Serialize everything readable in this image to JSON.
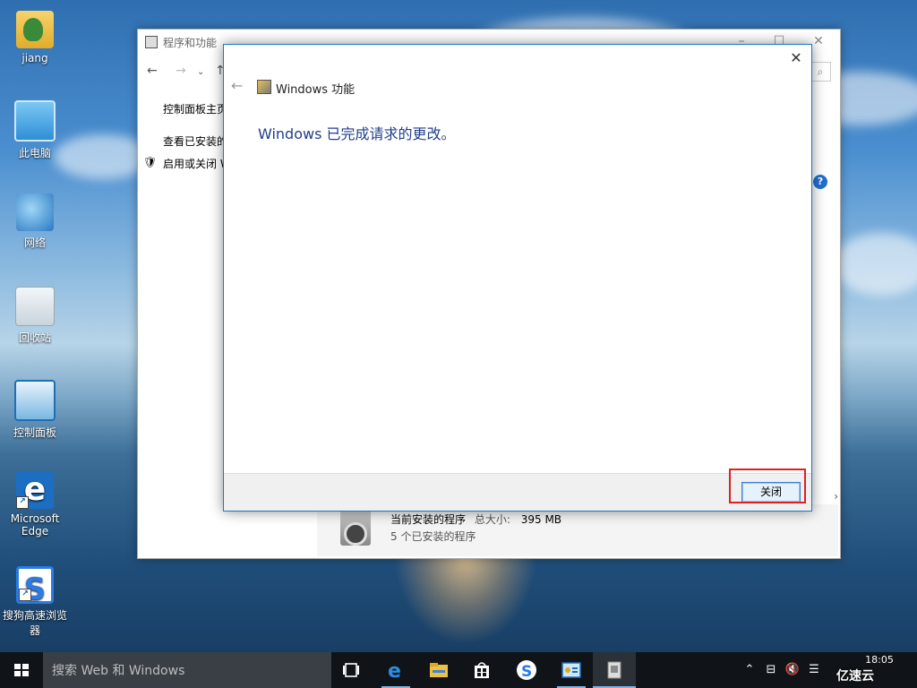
{
  "desktop": {
    "icons": [
      {
        "label": "jiang",
        "icon": "user-folder-icon"
      },
      {
        "label": "此电脑",
        "icon": "computer-icon"
      },
      {
        "label": "网络",
        "icon": "network-icon"
      },
      {
        "label": "回收站",
        "icon": "recycle-bin-icon"
      },
      {
        "label": "控制面板",
        "icon": "control-panel-icon"
      },
      {
        "label": "Microsoft Edge",
        "icon": "edge-icon"
      },
      {
        "label": "搜狗高速浏览器",
        "icon": "sogou-browser-icon"
      }
    ]
  },
  "background_window": {
    "title": "程序和功能",
    "left_links": [
      "控制面板主页",
      "查看已安装的",
      "启用或关闭 W"
    ],
    "footer": {
      "line1": "当前安装的程序",
      "size_label": "总大小:",
      "size_value": "395 MB",
      "line2": "5 个已安装的程序"
    },
    "help": "?"
  },
  "dialog": {
    "title": "Windows 功能",
    "message": "Windows 已完成请求的更改。",
    "close_button": "关闭"
  },
  "taskbar": {
    "search_placeholder": "搜索 Web 和 Windows",
    "apps": [
      "task-view-icon",
      "edge-icon",
      "file-explorer-icon",
      "store-icon",
      "sogou-browser-icon",
      "control-panel-icon",
      "windows-features-icon"
    ],
    "clock_time": "18:05"
  },
  "watermark": "亿速云",
  "colors": {
    "accent": "#1a78c8",
    "highlight_box": "#e02020",
    "heading": "#1e3f8a"
  }
}
